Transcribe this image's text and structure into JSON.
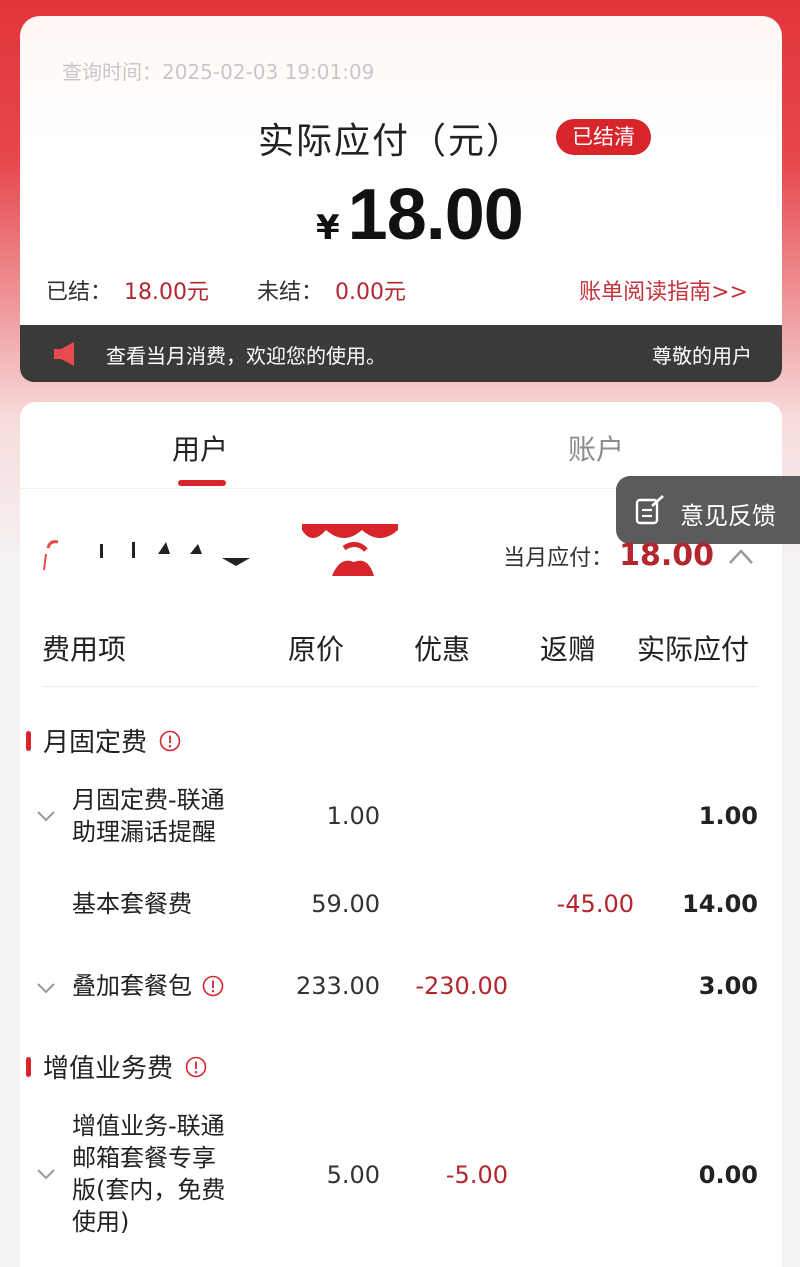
{
  "header": {
    "query_time": "查询时间：2025-02-03 19:01:09",
    "amount_title": "实际应付（元）",
    "status_badge": "已结清",
    "currency": "¥",
    "amount": "18.00",
    "settled_label": "已结：",
    "settled_value": "18.00元",
    "unsettled_label": "未结：",
    "unsettled_value": "0.00元",
    "guide_link": "账单阅读指南>>"
  },
  "notice": {
    "message": "查看当月消费，欢迎您的使用。",
    "user": "尊敬的用户"
  },
  "tabs": [
    {
      "label": "用户",
      "active": true
    },
    {
      "label": "账户",
      "active": false
    }
  ],
  "feedback": {
    "label": "意见反馈"
  },
  "summary": {
    "monthly_label": "当月应付：",
    "monthly_value": "18.00"
  },
  "table": {
    "headers": [
      "费用项",
      "原价",
      "优惠",
      "返赠",
      "实际应付"
    ],
    "sections": [
      {
        "title": "月固定费",
        "items": [
          {
            "name_lines": [
              "月固定费-联通",
              "助理漏话提醒"
            ],
            "original": "1.00",
            "discount": "",
            "rebate": "",
            "pay": "1.00",
            "expandable": true
          },
          {
            "name_lines": [
              "基本套餐费"
            ],
            "original": "59.00",
            "discount": "",
            "rebate": "-45.00",
            "pay": "14.00",
            "expandable": false
          },
          {
            "name_lines": [
              "叠加套餐包"
            ],
            "original": "233.00",
            "discount": "-230.00",
            "rebate": "",
            "pay": "3.00",
            "expandable": true,
            "info": true
          }
        ]
      },
      {
        "title": "增值业务费",
        "items": [
          {
            "name_lines": [
              "增值业务-联通",
              "邮箱套餐专享",
              "版(套内，免费",
              "使用)"
            ],
            "original": "5.00",
            "discount": "-5.00",
            "rebate": "",
            "pay": "0.00",
            "expandable": true
          }
        ]
      }
    ]
  },
  "colors": {
    "brand_red": "#d8252c",
    "value_red": "#b3262e",
    "notice_bg": "#3a3a3a",
    "feedback_bg": "#5b5b5b"
  },
  "icons": [
    "speaker-icon",
    "feedback-edit-icon",
    "chevron-up-icon",
    "info-icon",
    "chevron-down-icon"
  ]
}
